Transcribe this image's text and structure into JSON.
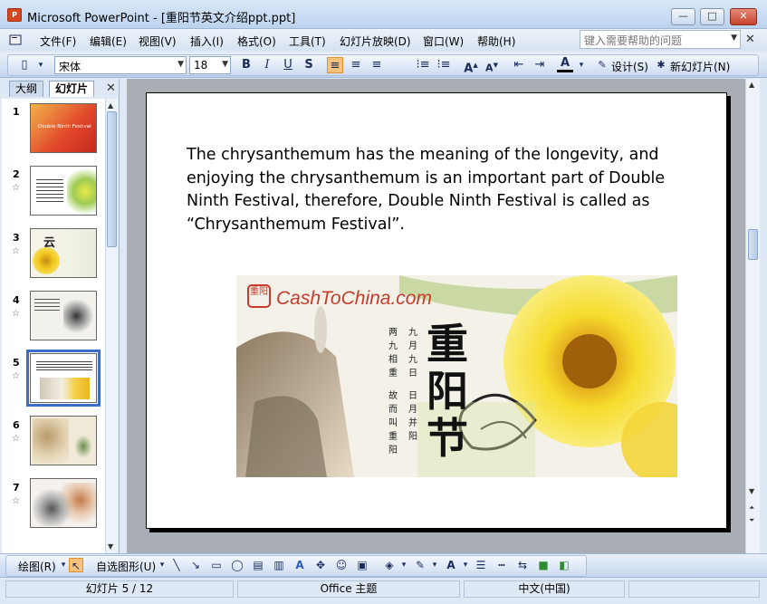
{
  "window": {
    "app_name": "Microsoft PowerPoint",
    "title": "Microsoft PowerPoint - [重阳节英文介绍ppt.ppt]",
    "icon_label": "P"
  },
  "menu": {
    "items": [
      "文件(F)",
      "编辑(E)",
      "视图(V)",
      "插入(I)",
      "格式(O)",
      "工具(T)",
      "幻灯片放映(D)",
      "窗口(W)",
      "帮助(H)"
    ],
    "help_placeholder": "键入需要帮助的问题"
  },
  "toolbar": {
    "font_name": "宋体",
    "font_size": "18",
    "design_label": "设计(S)",
    "new_slide_label": "新幻灯片(N)"
  },
  "left_pane": {
    "tabs": [
      "大纲",
      "幻灯片"
    ],
    "selected_slide": 5,
    "slides": [
      {
        "num": "1",
        "caption": "Double Ninth Festival"
      },
      {
        "num": "2",
        "caption": ""
      },
      {
        "num": "3",
        "caption": ""
      },
      {
        "num": "4",
        "caption": ""
      },
      {
        "num": "5",
        "caption": ""
      },
      {
        "num": "6",
        "caption": ""
      },
      {
        "num": "7",
        "caption": ""
      }
    ]
  },
  "slide": {
    "body_text": "The chrysanthemum has the meaning of the longevity, and enjoying the chrysanthemum is an important part of Double Ninth Festival, therefore, Double Ninth Festival is called as “Chrysanthemum Festival”.",
    "image": {
      "logo_text": "CashToChina.com",
      "seal_text": "重阳",
      "big_title": "重阳节",
      "poem_col_1": "九月九日",
      "poem_col_2": "两九相重",
      "poem_col_3": "日月并阳",
      "poem_col_4": "故而叫重阳"
    }
  },
  "draw_toolbar": {
    "draw_label": "绘图(R)",
    "autoshape_label": "自选图形(U)"
  },
  "status": {
    "slide_pos": "幻灯片 5 / 12",
    "theme": "Office 主题",
    "language": "中文(中国)"
  },
  "colors": {
    "accent": "#3b6fc7",
    "toolbar_bg": "#c5d6ee",
    "canvas_bg": "#a9adb4"
  }
}
